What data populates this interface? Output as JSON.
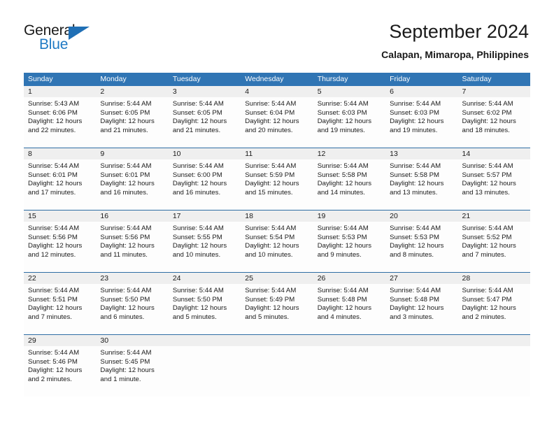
{
  "logo": {
    "word_one": "General",
    "word_two": "Blue",
    "triangle_icon": "triangle-icon",
    "accent_color": "#1f7ac4"
  },
  "header": {
    "title": "September 2024",
    "location": "Calapan, Mimaropa, Philippines"
  },
  "theme": {
    "header_blue": "#3075b4",
    "separator_blue": "#2e6da4",
    "daynum_gray": "#efefef",
    "cell_white": "#fdfdfd"
  },
  "weekday_headers": [
    "Sunday",
    "Monday",
    "Tuesday",
    "Wednesday",
    "Thursday",
    "Friday",
    "Saturday"
  ],
  "weeks": [
    [
      {
        "day": "1",
        "sunrise": "Sunrise: 5:43 AM",
        "sunset": "Sunset: 6:06 PM",
        "daylight_line1": "Daylight: 12 hours",
        "daylight_line2": "and 22 minutes."
      },
      {
        "day": "2",
        "sunrise": "Sunrise: 5:44 AM",
        "sunset": "Sunset: 6:05 PM",
        "daylight_line1": "Daylight: 12 hours",
        "daylight_line2": "and 21 minutes."
      },
      {
        "day": "3",
        "sunrise": "Sunrise: 5:44 AM",
        "sunset": "Sunset: 6:05 PM",
        "daylight_line1": "Daylight: 12 hours",
        "daylight_line2": "and 21 minutes."
      },
      {
        "day": "4",
        "sunrise": "Sunrise: 5:44 AM",
        "sunset": "Sunset: 6:04 PM",
        "daylight_line1": "Daylight: 12 hours",
        "daylight_line2": "and 20 minutes."
      },
      {
        "day": "5",
        "sunrise": "Sunrise: 5:44 AM",
        "sunset": "Sunset: 6:03 PM",
        "daylight_line1": "Daylight: 12 hours",
        "daylight_line2": "and 19 minutes."
      },
      {
        "day": "6",
        "sunrise": "Sunrise: 5:44 AM",
        "sunset": "Sunset: 6:03 PM",
        "daylight_line1": "Daylight: 12 hours",
        "daylight_line2": "and 19 minutes."
      },
      {
        "day": "7",
        "sunrise": "Sunrise: 5:44 AM",
        "sunset": "Sunset: 6:02 PM",
        "daylight_line1": "Daylight: 12 hours",
        "daylight_line2": "and 18 minutes."
      }
    ],
    [
      {
        "day": "8",
        "sunrise": "Sunrise: 5:44 AM",
        "sunset": "Sunset: 6:01 PM",
        "daylight_line1": "Daylight: 12 hours",
        "daylight_line2": "and 17 minutes."
      },
      {
        "day": "9",
        "sunrise": "Sunrise: 5:44 AM",
        "sunset": "Sunset: 6:01 PM",
        "daylight_line1": "Daylight: 12 hours",
        "daylight_line2": "and 16 minutes."
      },
      {
        "day": "10",
        "sunrise": "Sunrise: 5:44 AM",
        "sunset": "Sunset: 6:00 PM",
        "daylight_line1": "Daylight: 12 hours",
        "daylight_line2": "and 16 minutes."
      },
      {
        "day": "11",
        "sunrise": "Sunrise: 5:44 AM",
        "sunset": "Sunset: 5:59 PM",
        "daylight_line1": "Daylight: 12 hours",
        "daylight_line2": "and 15 minutes."
      },
      {
        "day": "12",
        "sunrise": "Sunrise: 5:44 AM",
        "sunset": "Sunset: 5:58 PM",
        "daylight_line1": "Daylight: 12 hours",
        "daylight_line2": "and 14 minutes."
      },
      {
        "day": "13",
        "sunrise": "Sunrise: 5:44 AM",
        "sunset": "Sunset: 5:58 PM",
        "daylight_line1": "Daylight: 12 hours",
        "daylight_line2": "and 13 minutes."
      },
      {
        "day": "14",
        "sunrise": "Sunrise: 5:44 AM",
        "sunset": "Sunset: 5:57 PM",
        "daylight_line1": "Daylight: 12 hours",
        "daylight_line2": "and 13 minutes."
      }
    ],
    [
      {
        "day": "15",
        "sunrise": "Sunrise: 5:44 AM",
        "sunset": "Sunset: 5:56 PM",
        "daylight_line1": "Daylight: 12 hours",
        "daylight_line2": "and 12 minutes."
      },
      {
        "day": "16",
        "sunrise": "Sunrise: 5:44 AM",
        "sunset": "Sunset: 5:56 PM",
        "daylight_line1": "Daylight: 12 hours",
        "daylight_line2": "and 11 minutes."
      },
      {
        "day": "17",
        "sunrise": "Sunrise: 5:44 AM",
        "sunset": "Sunset: 5:55 PM",
        "daylight_line1": "Daylight: 12 hours",
        "daylight_line2": "and 10 minutes."
      },
      {
        "day": "18",
        "sunrise": "Sunrise: 5:44 AM",
        "sunset": "Sunset: 5:54 PM",
        "daylight_line1": "Daylight: 12 hours",
        "daylight_line2": "and 10 minutes."
      },
      {
        "day": "19",
        "sunrise": "Sunrise: 5:44 AM",
        "sunset": "Sunset: 5:53 PM",
        "daylight_line1": "Daylight: 12 hours",
        "daylight_line2": "and 9 minutes."
      },
      {
        "day": "20",
        "sunrise": "Sunrise: 5:44 AM",
        "sunset": "Sunset: 5:53 PM",
        "daylight_line1": "Daylight: 12 hours",
        "daylight_line2": "and 8 minutes."
      },
      {
        "day": "21",
        "sunrise": "Sunrise: 5:44 AM",
        "sunset": "Sunset: 5:52 PM",
        "daylight_line1": "Daylight: 12 hours",
        "daylight_line2": "and 7 minutes."
      }
    ],
    [
      {
        "day": "22",
        "sunrise": "Sunrise: 5:44 AM",
        "sunset": "Sunset: 5:51 PM",
        "daylight_line1": "Daylight: 12 hours",
        "daylight_line2": "and 7 minutes."
      },
      {
        "day": "23",
        "sunrise": "Sunrise: 5:44 AM",
        "sunset": "Sunset: 5:50 PM",
        "daylight_line1": "Daylight: 12 hours",
        "daylight_line2": "and 6 minutes."
      },
      {
        "day": "24",
        "sunrise": "Sunrise: 5:44 AM",
        "sunset": "Sunset: 5:50 PM",
        "daylight_line1": "Daylight: 12 hours",
        "daylight_line2": "and 5 minutes."
      },
      {
        "day": "25",
        "sunrise": "Sunrise: 5:44 AM",
        "sunset": "Sunset: 5:49 PM",
        "daylight_line1": "Daylight: 12 hours",
        "daylight_line2": "and 5 minutes."
      },
      {
        "day": "26",
        "sunrise": "Sunrise: 5:44 AM",
        "sunset": "Sunset: 5:48 PM",
        "daylight_line1": "Daylight: 12 hours",
        "daylight_line2": "and 4 minutes."
      },
      {
        "day": "27",
        "sunrise": "Sunrise: 5:44 AM",
        "sunset": "Sunset: 5:48 PM",
        "daylight_line1": "Daylight: 12 hours",
        "daylight_line2": "and 3 minutes."
      },
      {
        "day": "28",
        "sunrise": "Sunrise: 5:44 AM",
        "sunset": "Sunset: 5:47 PM",
        "daylight_line1": "Daylight: 12 hours",
        "daylight_line2": "and 2 minutes."
      }
    ],
    [
      {
        "day": "29",
        "sunrise": "Sunrise: 5:44 AM",
        "sunset": "Sunset: 5:46 PM",
        "daylight_line1": "Daylight: 12 hours",
        "daylight_line2": "and 2 minutes."
      },
      {
        "day": "30",
        "sunrise": "Sunrise: 5:44 AM",
        "sunset": "Sunset: 5:45 PM",
        "daylight_line1": "Daylight: 12 hours",
        "daylight_line2": "and 1 minute."
      },
      {
        "day": "",
        "sunrise": "",
        "sunset": "",
        "daylight_line1": "",
        "daylight_line2": ""
      },
      {
        "day": "",
        "sunrise": "",
        "sunset": "",
        "daylight_line1": "",
        "daylight_line2": ""
      },
      {
        "day": "",
        "sunrise": "",
        "sunset": "",
        "daylight_line1": "",
        "daylight_line2": ""
      },
      {
        "day": "",
        "sunrise": "",
        "sunset": "",
        "daylight_line1": "",
        "daylight_line2": ""
      },
      {
        "day": "",
        "sunrise": "",
        "sunset": "",
        "daylight_line1": "",
        "daylight_line2": ""
      }
    ]
  ]
}
